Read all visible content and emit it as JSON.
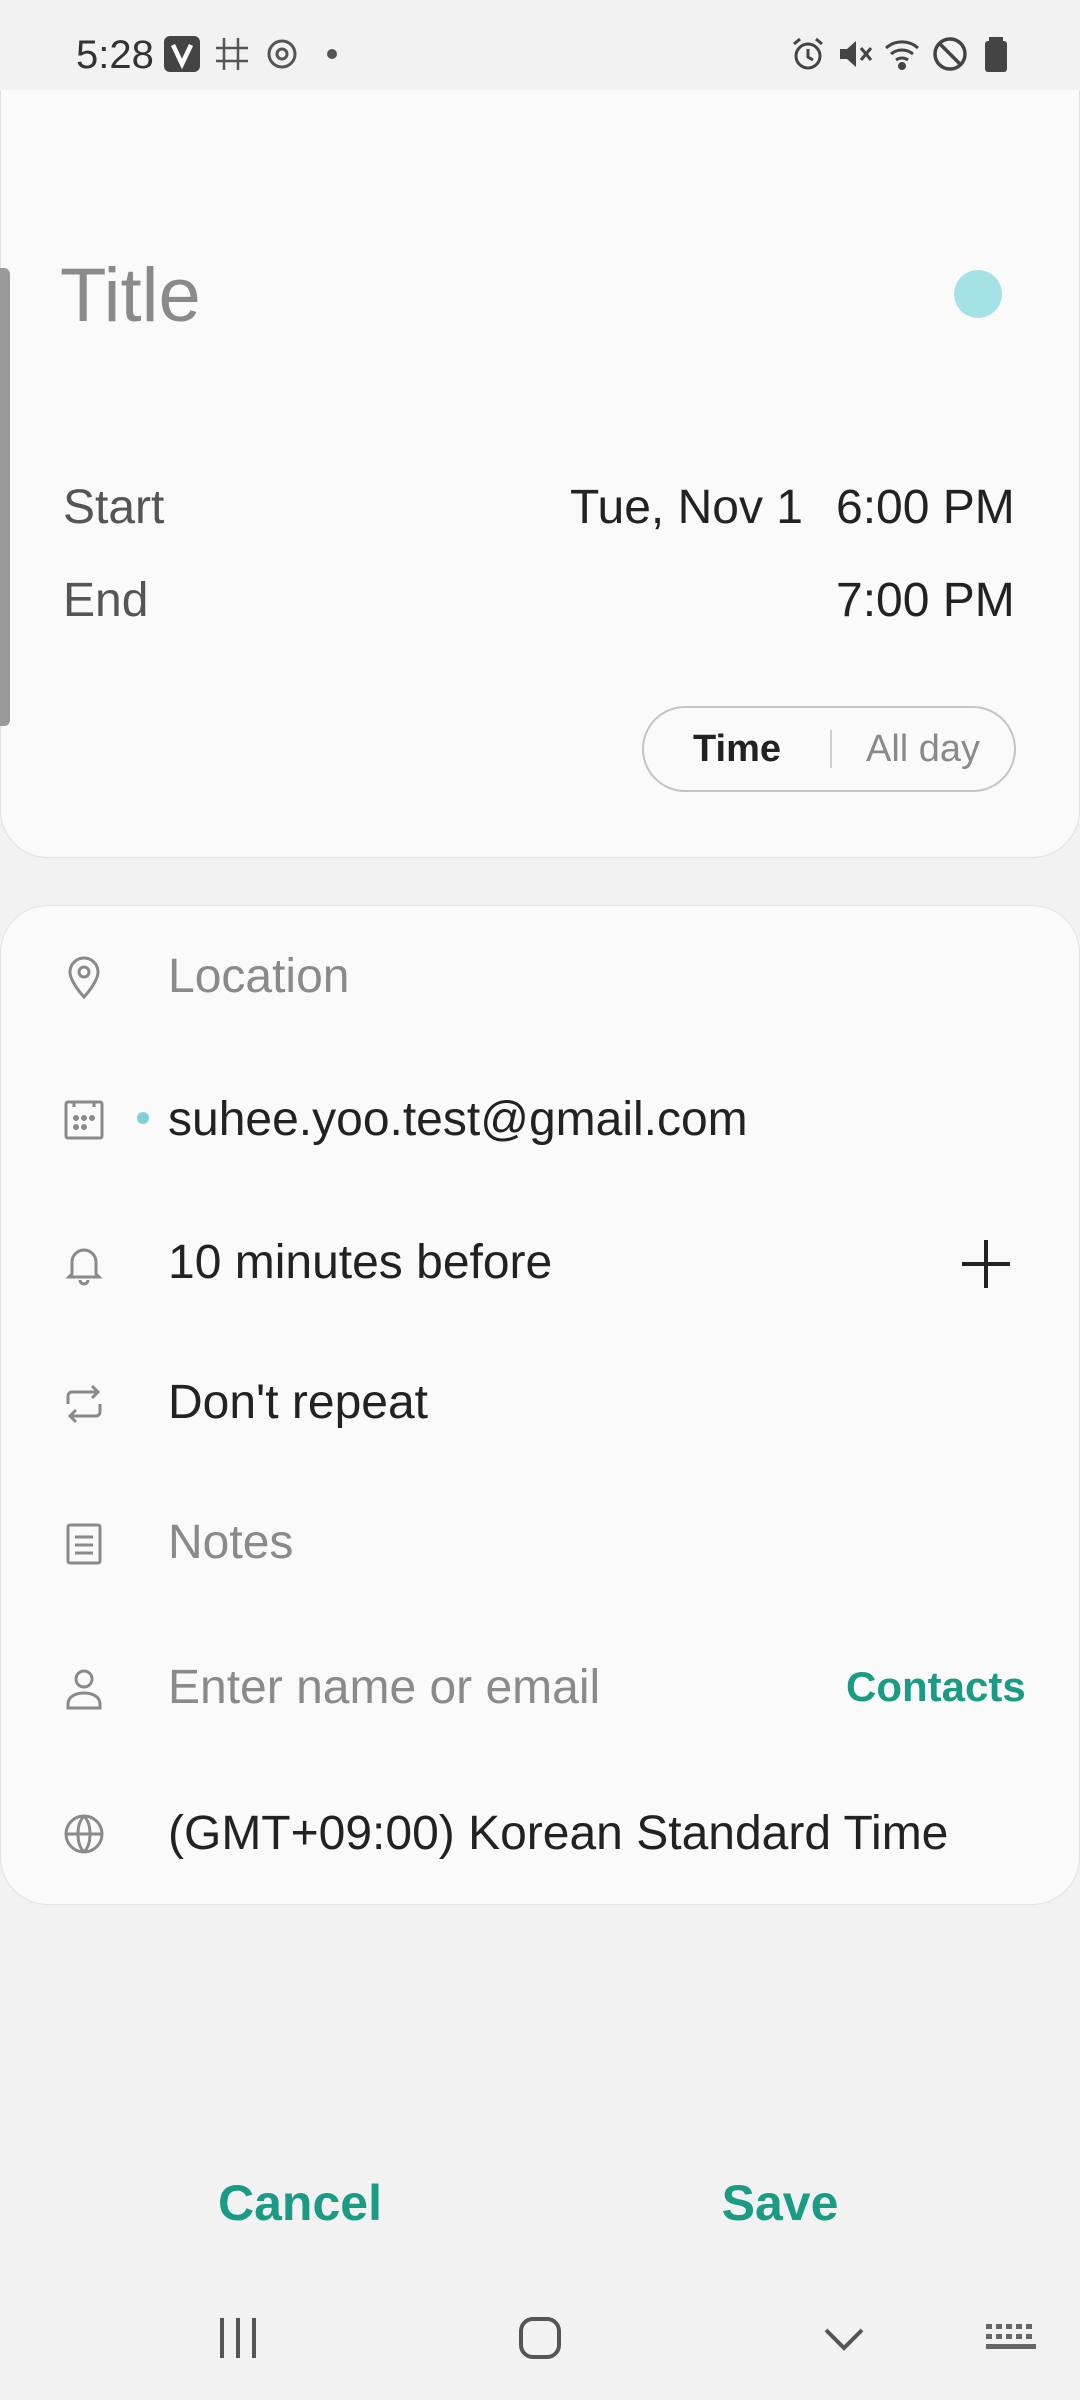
{
  "status_bar": {
    "time": "5:28",
    "notification_icons": [
      "v-app-icon",
      "grid-icon",
      "sync-icon",
      "dot-icon"
    ],
    "system_icons": [
      "alarm-icon",
      "mute-icon",
      "wifi-icon",
      "dnd-icon",
      "battery-icon"
    ]
  },
  "event": {
    "title_placeholder": "Title",
    "color": "#a5e2e6",
    "start_label": "Start",
    "start_date": "Tue, Nov 1",
    "start_time": "6:00 PM",
    "end_label": "End",
    "end_time": "7:00 PM",
    "mode_time": "Time",
    "mode_allday": "All day"
  },
  "details": {
    "location_placeholder": "Location",
    "calendar_account": "suhee.yoo.test@gmail.com",
    "reminder": "10 minutes before",
    "repeat": "Don't repeat",
    "notes_placeholder": "Notes",
    "invitee_placeholder": "Enter name or email",
    "contacts_label": "Contacts",
    "timezone": "(GMT+09:00) Korean Standard Time"
  },
  "actions": {
    "cancel": "Cancel",
    "save": "Save"
  },
  "colors": {
    "accent": "#1a9b84",
    "event_color": "#a5e2e6"
  }
}
